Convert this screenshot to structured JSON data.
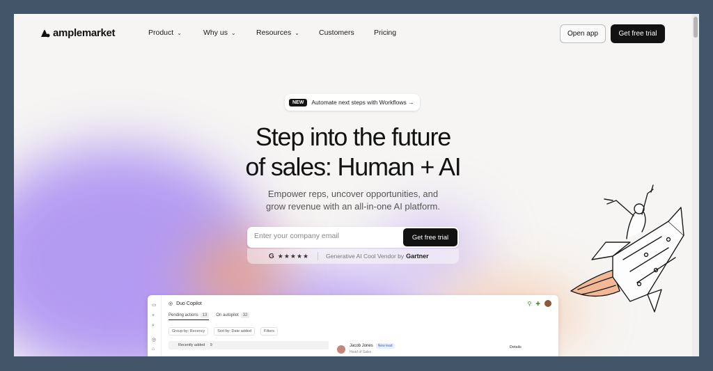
{
  "brand": {
    "name": "amplemarket"
  },
  "nav": {
    "items": [
      {
        "label": "Product",
        "has_dropdown": true
      },
      {
        "label": "Why us",
        "has_dropdown": true
      },
      {
        "label": "Resources",
        "has_dropdown": true
      },
      {
        "label": "Customers",
        "has_dropdown": false
      },
      {
        "label": "Pricing",
        "has_dropdown": false
      }
    ],
    "open_app": "Open app",
    "free_trial": "Get free trial"
  },
  "hero": {
    "badge": "NEW",
    "announcement": "Automate next steps with Workflows →",
    "headline_line1": "Step into the future",
    "headline_line2": "of sales: Human + AI",
    "sub_line1": "Empower reps, uncover opportunities, and",
    "sub_line2": "grow revenue with an all-in-one AI platform.",
    "email_placeholder": "Enter your company email",
    "cta": "Get free trial",
    "review_logo": "G",
    "stars": "★★★★★",
    "vendor_text": "Generative AI Cool Vendor by",
    "vendor_brand": "Gartner"
  },
  "preview": {
    "title": "Duo Copilot",
    "tabs": [
      {
        "label": "Pending actions",
        "count": "13"
      },
      {
        "label": "On autopilot",
        "count": "32"
      }
    ],
    "group_by": "Group by: Recency",
    "sort_by": "Sort by: Date added",
    "filters": "Filters",
    "group_label": "Recently added",
    "group_count": "9",
    "person_name": "Jacob Jones",
    "person_badge": "New lead",
    "person_role": "Head of Sales",
    "details": "Details"
  },
  "colors": {
    "page_bg": "#435569",
    "accent_dark": "#121212",
    "purple": "#a98cf2",
    "orange": "#f5a66f"
  }
}
